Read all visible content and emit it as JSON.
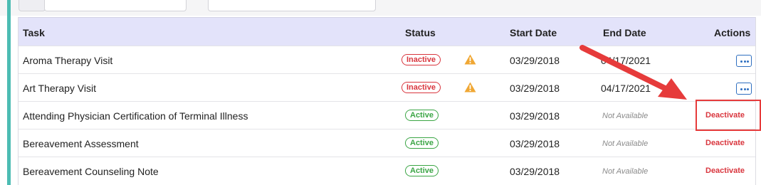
{
  "table": {
    "headers": {
      "task": "Task",
      "status": "Status",
      "start_date": "Start Date",
      "end_date": "End Date",
      "actions": "Actions"
    },
    "rows": [
      {
        "task": "Aroma Therapy Visit",
        "status": "Inactive",
        "start_date": "03/29/2018",
        "end_date": "04/17/2021"
      },
      {
        "task": "Art Therapy Visit",
        "status": "Inactive",
        "start_date": "03/29/2018",
        "end_date": "04/17/2021"
      },
      {
        "task": "Attending Physician Certification of Terminal Illness",
        "status": "Active",
        "start_date": "03/29/2018",
        "end_date": "Not Available",
        "action": "Deactivate"
      },
      {
        "task": "Bereavement Assessment",
        "status": "Active",
        "start_date": "03/29/2018",
        "end_date": "Not Available",
        "action": "Deactivate"
      },
      {
        "task": "Bereavement Counseling Note",
        "status": "Active",
        "start_date": "03/29/2018",
        "end_date": "Not Available",
        "action": "Deactivate"
      }
    ]
  },
  "colors": {
    "header_bg": "#e3e3fa",
    "accent": "#4cbcb3",
    "inactive": "#d9363e",
    "active": "#3aa544",
    "warning": "#f0a733",
    "action_link": "#d9363e",
    "annotation": "#e63b3b"
  },
  "icons": {
    "warning": "warning-triangle-icon",
    "more": "more-options-icon"
  }
}
